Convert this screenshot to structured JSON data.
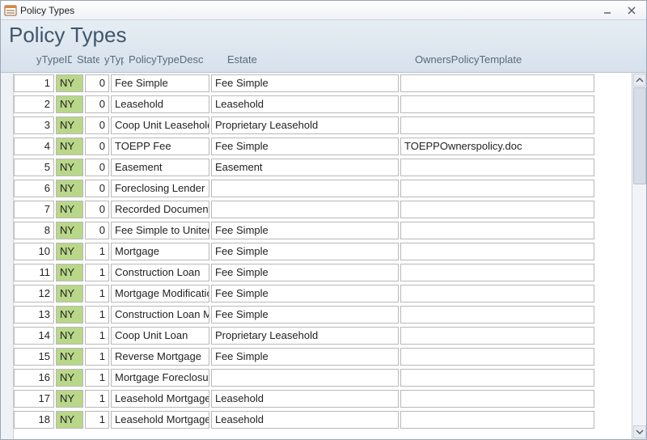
{
  "window": {
    "title": "Policy Types"
  },
  "form": {
    "title": "Policy Types"
  },
  "columns": {
    "id": "yTypeID",
    "state": "State",
    "type": "yType",
    "desc": "PolicyTypeDesc",
    "estate": "Estate",
    "tmpl": "OwnersPolicyTemplate"
  },
  "rows": [
    {
      "id": "1",
      "state": "NY",
      "type": "0",
      "desc": "Fee Simple",
      "estate": "Fee Simple",
      "tmpl": ""
    },
    {
      "id": "2",
      "state": "NY",
      "type": "0",
      "desc": "Leasehold",
      "estate": "Leasehold",
      "tmpl": ""
    },
    {
      "id": "3",
      "state": "NY",
      "type": "0",
      "desc": "Coop Unit Leasehold",
      "estate": "Proprietary Leasehold",
      "tmpl": ""
    },
    {
      "id": "4",
      "state": "NY",
      "type": "0",
      "desc": "TOEPP Fee",
      "estate": "Fee Simple",
      "tmpl": "TOEPPOwnerspolicy.doc"
    },
    {
      "id": "5",
      "state": "NY",
      "type": "0",
      "desc": "Easement",
      "estate": "Easement",
      "tmpl": ""
    },
    {
      "id": "6",
      "state": "NY",
      "type": "0",
      "desc": "Foreclosing Lender",
      "estate": "",
      "tmpl": ""
    },
    {
      "id": "7",
      "state": "NY",
      "type": "0",
      "desc": "Recorded Document",
      "estate": "",
      "tmpl": ""
    },
    {
      "id": "8",
      "state": "NY",
      "type": "0",
      "desc": "Fee Simple to United",
      "estate": "Fee Simple",
      "tmpl": ""
    },
    {
      "id": "10",
      "state": "NY",
      "type": "1",
      "desc": "Mortgage",
      "estate": "Fee Simple",
      "tmpl": ""
    },
    {
      "id": "11",
      "state": "NY",
      "type": "1",
      "desc": "Construction Loan",
      "estate": "Fee Simple",
      "tmpl": ""
    },
    {
      "id": "12",
      "state": "NY",
      "type": "1",
      "desc": "Mortgage Modification",
      "estate": "Fee Simple",
      "tmpl": ""
    },
    {
      "id": "13",
      "state": "NY",
      "type": "1",
      "desc": "Construction Loan M",
      "estate": "Fee Simple",
      "tmpl": ""
    },
    {
      "id": "14",
      "state": "NY",
      "type": "1",
      "desc": "Coop Unit Loan",
      "estate": "Proprietary Leasehold",
      "tmpl": ""
    },
    {
      "id": "15",
      "state": "NY",
      "type": "1",
      "desc": "Reverse Mortgage",
      "estate": "Fee Simple",
      "tmpl": ""
    },
    {
      "id": "16",
      "state": "NY",
      "type": "1",
      "desc": "Mortgage Foreclosure",
      "estate": "",
      "tmpl": ""
    },
    {
      "id": "17",
      "state": "NY",
      "type": "1",
      "desc": "Leasehold Mortgage",
      "estate": "Leasehold",
      "tmpl": ""
    },
    {
      "id": "18",
      "state": "NY",
      "type": "1",
      "desc": "Leasehold Mortgage",
      "estate": "Leasehold",
      "tmpl": ""
    }
  ]
}
